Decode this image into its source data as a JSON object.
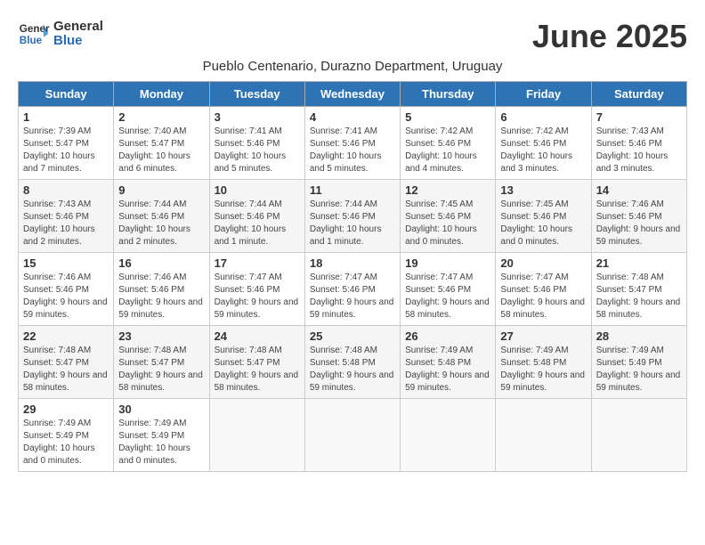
{
  "header": {
    "logo_line1": "General",
    "logo_line2": "Blue",
    "month_title": "June 2025",
    "subtitle": "Pueblo Centenario, Durazno Department, Uruguay"
  },
  "days_of_week": [
    "Sunday",
    "Monday",
    "Tuesday",
    "Wednesday",
    "Thursday",
    "Friday",
    "Saturday"
  ],
  "weeks": [
    [
      {
        "day": 1,
        "sunrise": "Sunrise: 7:39 AM",
        "sunset": "Sunset: 5:47 PM",
        "daylight": "Daylight: 10 hours and 7 minutes."
      },
      {
        "day": 2,
        "sunrise": "Sunrise: 7:40 AM",
        "sunset": "Sunset: 5:47 PM",
        "daylight": "Daylight: 10 hours and 6 minutes."
      },
      {
        "day": 3,
        "sunrise": "Sunrise: 7:41 AM",
        "sunset": "Sunset: 5:46 PM",
        "daylight": "Daylight: 10 hours and 5 minutes."
      },
      {
        "day": 4,
        "sunrise": "Sunrise: 7:41 AM",
        "sunset": "Sunset: 5:46 PM",
        "daylight": "Daylight: 10 hours and 5 minutes."
      },
      {
        "day": 5,
        "sunrise": "Sunrise: 7:42 AM",
        "sunset": "Sunset: 5:46 PM",
        "daylight": "Daylight: 10 hours and 4 minutes."
      },
      {
        "day": 6,
        "sunrise": "Sunrise: 7:42 AM",
        "sunset": "Sunset: 5:46 PM",
        "daylight": "Daylight: 10 hours and 3 minutes."
      },
      {
        "day": 7,
        "sunrise": "Sunrise: 7:43 AM",
        "sunset": "Sunset: 5:46 PM",
        "daylight": "Daylight: 10 hours and 3 minutes."
      }
    ],
    [
      {
        "day": 8,
        "sunrise": "Sunrise: 7:43 AM",
        "sunset": "Sunset: 5:46 PM",
        "daylight": "Daylight: 10 hours and 2 minutes."
      },
      {
        "day": 9,
        "sunrise": "Sunrise: 7:44 AM",
        "sunset": "Sunset: 5:46 PM",
        "daylight": "Daylight: 10 hours and 2 minutes."
      },
      {
        "day": 10,
        "sunrise": "Sunrise: 7:44 AM",
        "sunset": "Sunset: 5:46 PM",
        "daylight": "Daylight: 10 hours and 1 minute."
      },
      {
        "day": 11,
        "sunrise": "Sunrise: 7:44 AM",
        "sunset": "Sunset: 5:46 PM",
        "daylight": "Daylight: 10 hours and 1 minute."
      },
      {
        "day": 12,
        "sunrise": "Sunrise: 7:45 AM",
        "sunset": "Sunset: 5:46 PM",
        "daylight": "Daylight: 10 hours and 0 minutes."
      },
      {
        "day": 13,
        "sunrise": "Sunrise: 7:45 AM",
        "sunset": "Sunset: 5:46 PM",
        "daylight": "Daylight: 10 hours and 0 minutes."
      },
      {
        "day": 14,
        "sunrise": "Sunrise: 7:46 AM",
        "sunset": "Sunset: 5:46 PM",
        "daylight": "Daylight: 9 hours and 59 minutes."
      }
    ],
    [
      {
        "day": 15,
        "sunrise": "Sunrise: 7:46 AM",
        "sunset": "Sunset: 5:46 PM",
        "daylight": "Daylight: 9 hours and 59 minutes."
      },
      {
        "day": 16,
        "sunrise": "Sunrise: 7:46 AM",
        "sunset": "Sunset: 5:46 PM",
        "daylight": "Daylight: 9 hours and 59 minutes."
      },
      {
        "day": 17,
        "sunrise": "Sunrise: 7:47 AM",
        "sunset": "Sunset: 5:46 PM",
        "daylight": "Daylight: 9 hours and 59 minutes."
      },
      {
        "day": 18,
        "sunrise": "Sunrise: 7:47 AM",
        "sunset": "Sunset: 5:46 PM",
        "daylight": "Daylight: 9 hours and 59 minutes."
      },
      {
        "day": 19,
        "sunrise": "Sunrise: 7:47 AM",
        "sunset": "Sunset: 5:46 PM",
        "daylight": "Daylight: 9 hours and 58 minutes."
      },
      {
        "day": 20,
        "sunrise": "Sunrise: 7:47 AM",
        "sunset": "Sunset: 5:46 PM",
        "daylight": "Daylight: 9 hours and 58 minutes."
      },
      {
        "day": 21,
        "sunrise": "Sunrise: 7:48 AM",
        "sunset": "Sunset: 5:47 PM",
        "daylight": "Daylight: 9 hours and 58 minutes."
      }
    ],
    [
      {
        "day": 22,
        "sunrise": "Sunrise: 7:48 AM",
        "sunset": "Sunset: 5:47 PM",
        "daylight": "Daylight: 9 hours and 58 minutes."
      },
      {
        "day": 23,
        "sunrise": "Sunrise: 7:48 AM",
        "sunset": "Sunset: 5:47 PM",
        "daylight": "Daylight: 9 hours and 58 minutes."
      },
      {
        "day": 24,
        "sunrise": "Sunrise: 7:48 AM",
        "sunset": "Sunset: 5:47 PM",
        "daylight": "Daylight: 9 hours and 58 minutes."
      },
      {
        "day": 25,
        "sunrise": "Sunrise: 7:48 AM",
        "sunset": "Sunset: 5:48 PM",
        "daylight": "Daylight: 9 hours and 59 minutes."
      },
      {
        "day": 26,
        "sunrise": "Sunrise: 7:49 AM",
        "sunset": "Sunset: 5:48 PM",
        "daylight": "Daylight: 9 hours and 59 minutes."
      },
      {
        "day": 27,
        "sunrise": "Sunrise: 7:49 AM",
        "sunset": "Sunset: 5:48 PM",
        "daylight": "Daylight: 9 hours and 59 minutes."
      },
      {
        "day": 28,
        "sunrise": "Sunrise: 7:49 AM",
        "sunset": "Sunset: 5:49 PM",
        "daylight": "Daylight: 9 hours and 59 minutes."
      }
    ],
    [
      {
        "day": 29,
        "sunrise": "Sunrise: 7:49 AM",
        "sunset": "Sunset: 5:49 PM",
        "daylight": "Daylight: 10 hours and 0 minutes."
      },
      {
        "day": 30,
        "sunrise": "Sunrise: 7:49 AM",
        "sunset": "Sunset: 5:49 PM",
        "daylight": "Daylight: 10 hours and 0 minutes."
      },
      null,
      null,
      null,
      null,
      null
    ]
  ]
}
